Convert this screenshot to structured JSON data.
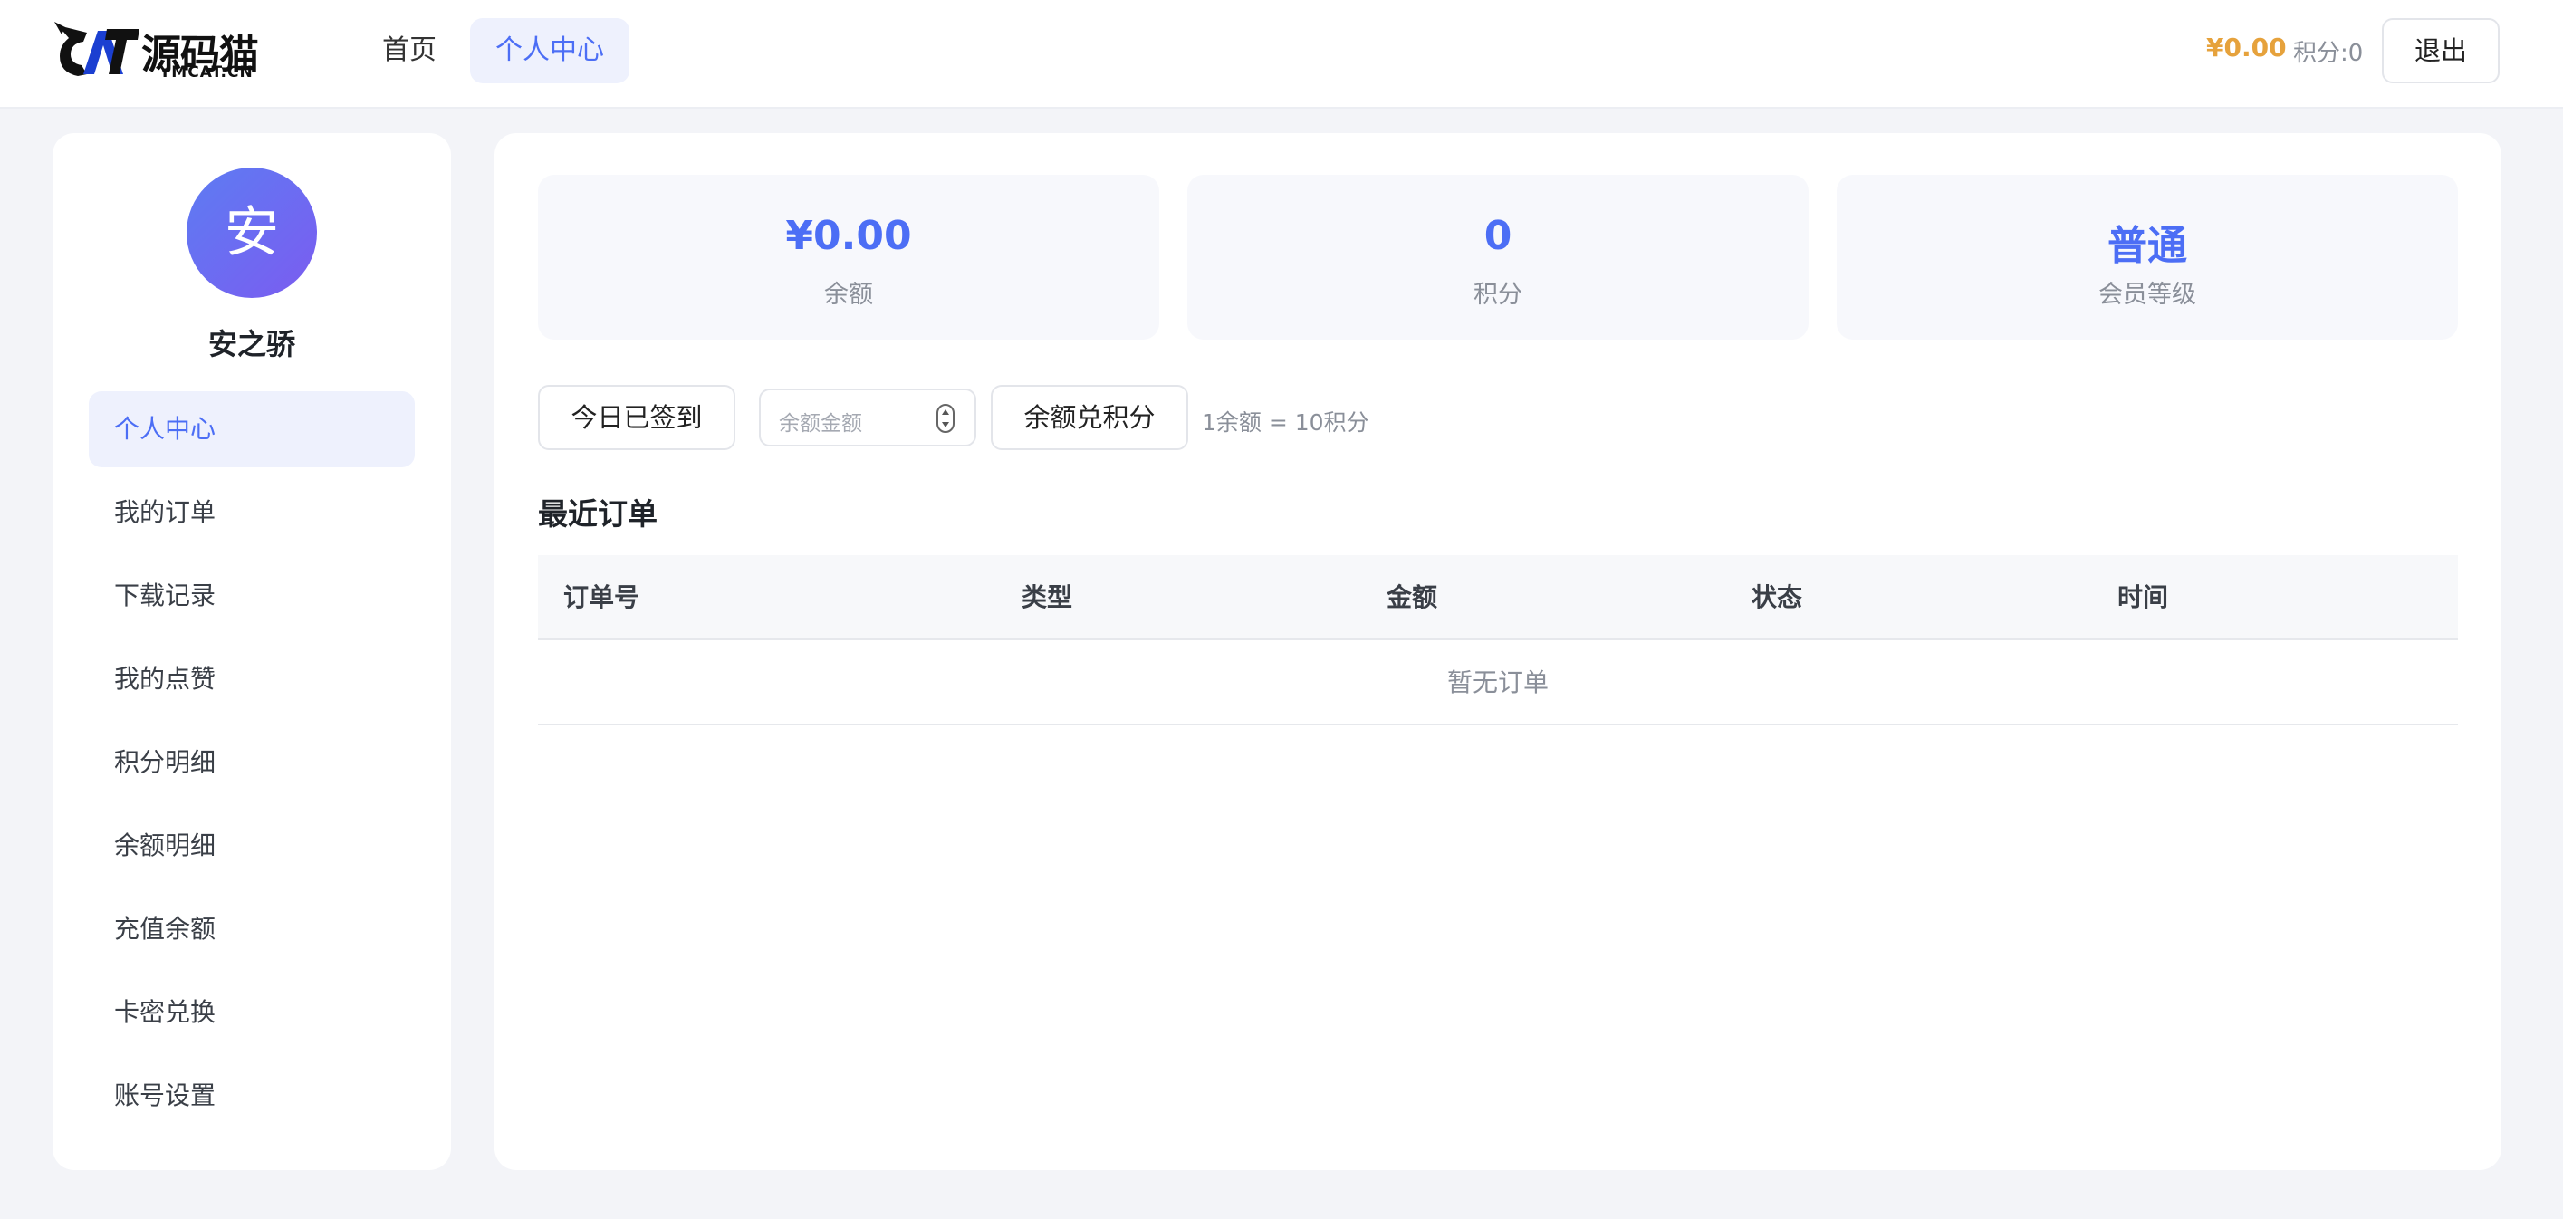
{
  "header": {
    "logo": {
      "wordmark": "源码猫",
      "sub": "YMCAT.CN"
    },
    "nav": [
      {
        "label": "首页",
        "active": false
      },
      {
        "label": "个人中心",
        "active": true
      }
    ],
    "balance": "¥0.00",
    "points": "积分:0",
    "logout_label": "退出"
  },
  "sidebar": {
    "avatar_char": "安",
    "username": "安之骄",
    "items": [
      {
        "label": "个人中心",
        "active": true
      },
      {
        "label": "我的订单",
        "active": false
      },
      {
        "label": "下载记录",
        "active": false
      },
      {
        "label": "我的点赞",
        "active": false
      },
      {
        "label": "积分明细",
        "active": false
      },
      {
        "label": "余额明细",
        "active": false
      },
      {
        "label": "充值余额",
        "active": false
      },
      {
        "label": "卡密兑换",
        "active": false
      },
      {
        "label": "账号设置",
        "active": false
      }
    ]
  },
  "stats": [
    {
      "value": "¥0.00",
      "label": "余额"
    },
    {
      "value": "0",
      "label": "积分"
    },
    {
      "value": "普通",
      "label": "会员等级"
    }
  ],
  "actions": {
    "checkin_label": "今日已签到",
    "amount_placeholder": "余额金额",
    "exchange_label": "余额兑积分",
    "rate_note": "1余额 = 10积分"
  },
  "orders": {
    "title": "最近订单",
    "columns": [
      "订单号",
      "类型",
      "金额",
      "状态",
      "时间"
    ],
    "empty_text": "暂无订单"
  },
  "colors": {
    "accent": "#4c6ef5",
    "balance_gold": "#e6a23c",
    "page_bg": "#f3f4f8"
  }
}
